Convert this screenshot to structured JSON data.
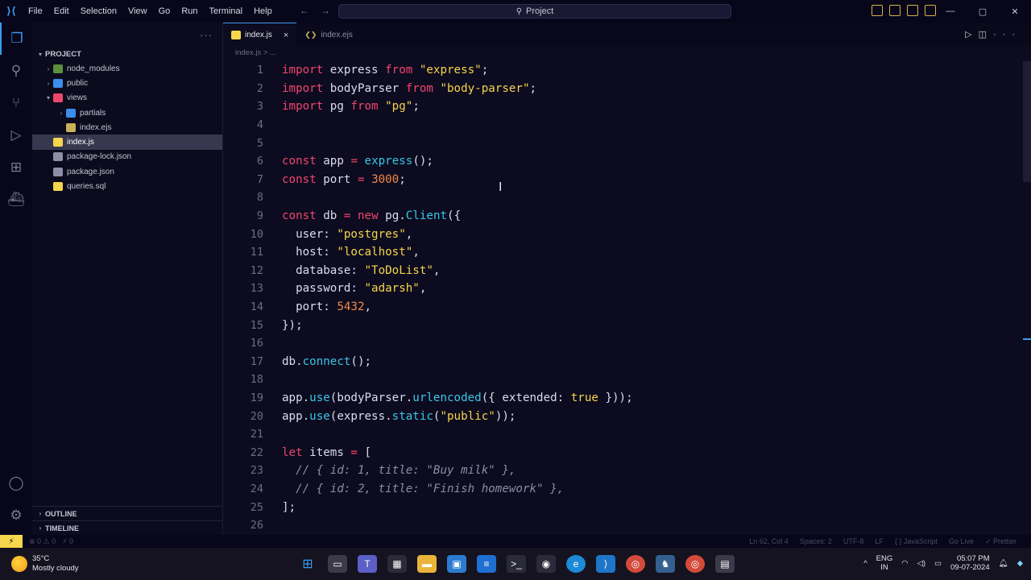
{
  "titlebar": {
    "menu": [
      "File",
      "Edit",
      "Selection",
      "View",
      "Go",
      "Run",
      "Terminal",
      "Help"
    ],
    "search": "Project",
    "nav_back": "←",
    "nav_forward": "→"
  },
  "sidebar": {
    "project_label": "PROJECT",
    "more": "···",
    "items": [
      {
        "label": "node_modules",
        "icon_color": "#5a8f3c"
      },
      {
        "label": "public",
        "icon_color": "#3b8eea"
      },
      {
        "label": "views",
        "icon_color": "#f0466e"
      },
      {
        "label": "partials",
        "icon_color": "#3b8eea"
      },
      {
        "label": "index.ejs",
        "icon_color": "#c8b35a"
      },
      {
        "label": "index.js",
        "icon_color": "#f5d64c"
      },
      {
        "label": "package-lock.json",
        "icon_color": "#8e8ea6"
      },
      {
        "label": "package.json",
        "icon_color": "#8e8ea6"
      },
      {
        "label": "queries.sql",
        "icon_color": "#f5d64c"
      }
    ],
    "sections": [
      "OUTLINE",
      "TIMELINE"
    ]
  },
  "tabs": [
    {
      "label": "index.js",
      "active": true,
      "close": "×"
    },
    {
      "label": "index.ejs",
      "active": false
    }
  ],
  "breadcrumb": "index.js > ...",
  "editor": {
    "line_numbers": [
      "1",
      "2",
      "3",
      "4",
      "5",
      "6",
      "7",
      "8",
      "9",
      "10",
      "11",
      "12",
      "13",
      "14",
      "15",
      "16",
      "17",
      "18",
      "19",
      "20",
      "21",
      "22",
      "23",
      "24",
      "25",
      "26"
    ]
  },
  "statusbar": {
    "problems": "⊗ 0 ⚠ 0",
    "ports": "⚡ 0",
    "position": "Ln 62, Col 4",
    "spaces": "Spaces: 2",
    "encoding": "UTF-8",
    "eol": "LF",
    "language": "{ } JavaScript",
    "golive": "Go Live",
    "prettier": "✓ Prettier"
  },
  "taskbar": {
    "temperature": "35°C",
    "weather": "Mostly cloudy",
    "lang1": "ENG",
    "lang2": "IN",
    "time": "05:07 PM",
    "date": "09-07-2024"
  },
  "colors": {
    "accent": "#3b9cf0",
    "keyword": "#f0466e",
    "string": "#f5d64c",
    "number": "#f08a48",
    "function": "#38c7e6"
  }
}
